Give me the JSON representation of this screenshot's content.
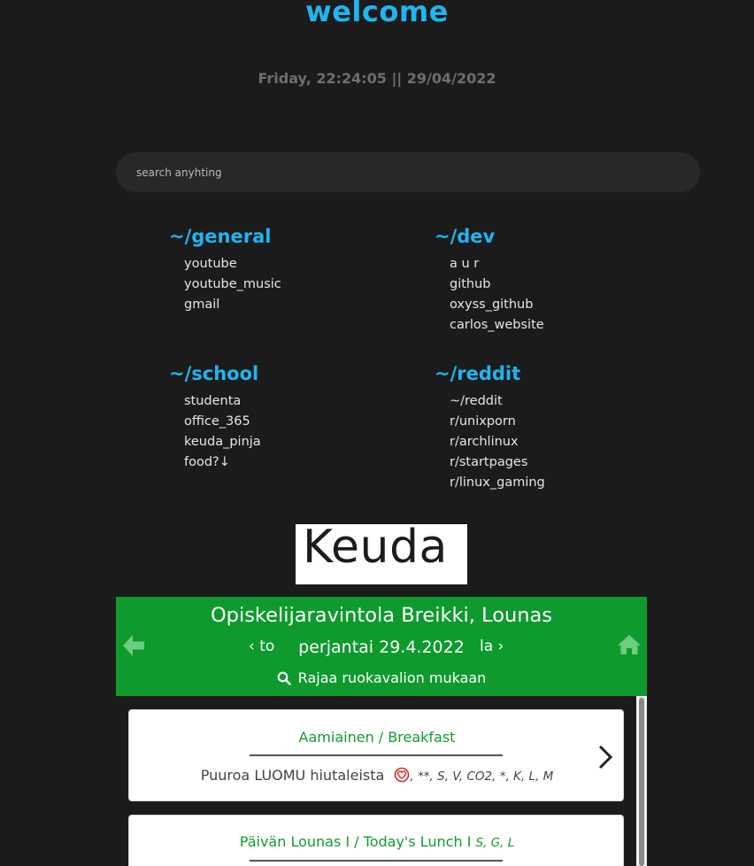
{
  "header": {
    "title": "welcome",
    "clock": "Friday, 22:24:05 || 29/04/2022"
  },
  "search": {
    "placeholder": "search anyhting"
  },
  "groups": [
    {
      "title": "~/general",
      "links": [
        "youtube",
        "youtube_music",
        "gmail"
      ]
    },
    {
      "title": "~/dev",
      "links": [
        "a u r",
        "github",
        "oxyss_github",
        "carlos_website"
      ]
    },
    {
      "title": "~/school",
      "links": [
        "studenta",
        "office_365",
        "keuda_pinja",
        "food?↓"
      ]
    },
    {
      "title": "~/reddit",
      "links": [
        "~/reddit",
        "r/unixporn",
        "r/archlinux",
        "r/startpages",
        "r/linux_gaming"
      ]
    }
  ],
  "logo": {
    "text": "Keuda"
  },
  "menu": {
    "restaurant": "Opiskelijaravintola Breikki, Lounas",
    "prev_label": "to",
    "date": "perjantai 29.4.2022",
    "next_label": "la",
    "filter_label": "Rajaa ruokavalion mukaan",
    "cards": [
      {
        "title": "Aamiainen / Breakfast",
        "item": "Puuroa LUOMU hiutaleista",
        "tags": ", **, S, V, CO2, *, K, L, M"
      },
      {
        "title": "Päivän Lounas I / Today's Lunch I",
        "title_tags": "S, G, L"
      }
    ]
  },
  "icons": {
    "back": "arrow-left-icon",
    "home": "home-icon",
    "filter": "search-icon",
    "prev": "chevron-left-icon",
    "next": "chevron-right-icon",
    "card_next": "chevron-right-icon",
    "diet": "heart-icon"
  },
  "colors": {
    "background": "#1b1b1b",
    "accent": "#1fb5f0",
    "menu_green": "#0e9a2d",
    "card_title_green": "#119c30"
  }
}
